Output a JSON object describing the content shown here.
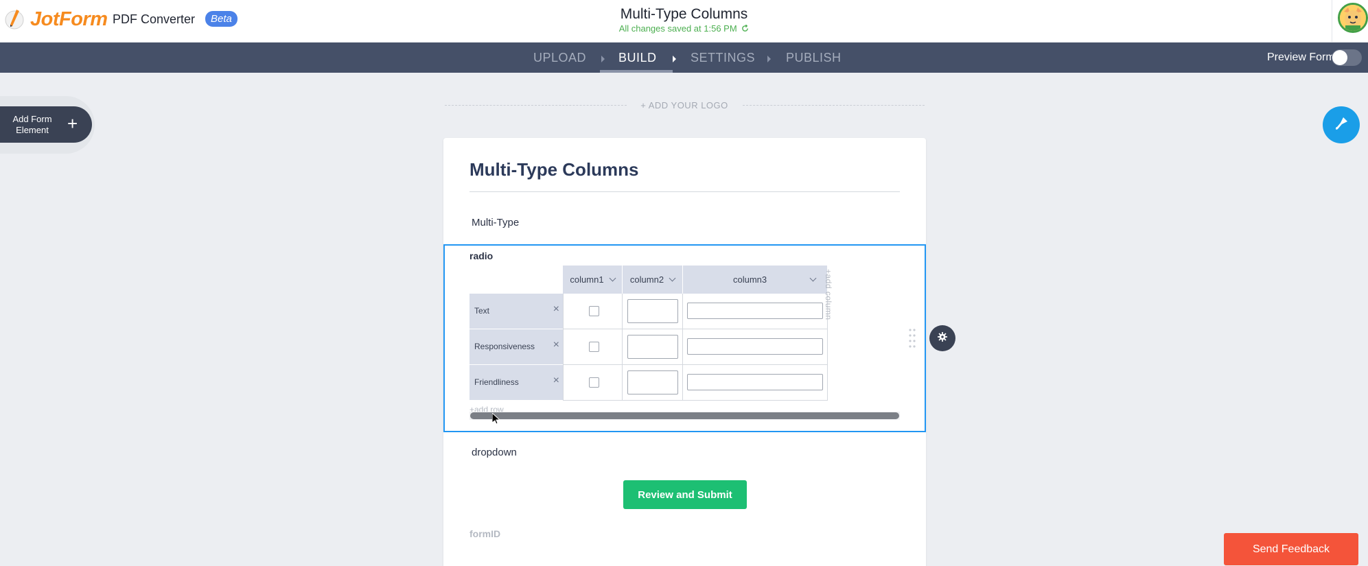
{
  "header": {
    "brand": "JotForm",
    "product": "PDF Converter",
    "badge": "Beta",
    "title": "Multi-Type Columns",
    "save_status": "All changes saved at 1:56 PM"
  },
  "nav": {
    "items": [
      {
        "label": "UPLOAD",
        "active": false
      },
      {
        "label": "BUILD",
        "active": true
      },
      {
        "label": "SETTINGS",
        "active": false
      },
      {
        "label": "PUBLISH",
        "active": false
      }
    ],
    "preview_label": "Preview Form",
    "preview_on": false
  },
  "sidebar": {
    "add_element_label": "Add Form Element"
  },
  "logo_placeholder": "+ ADD YOUR LOGO",
  "form": {
    "title": "Multi-Type Columns",
    "field1_label": "Multi-Type",
    "matrix": {
      "label": "radio",
      "columns": [
        "column1",
        "column2",
        "column3"
      ],
      "rows": [
        "Text",
        "Responsiveness",
        "Friendliness"
      ],
      "add_column": "+add column",
      "add_row": "+add row"
    },
    "field3_label": "dropdown",
    "submit_label": "Review and Submit",
    "formid_label": "formID"
  },
  "feedback_label": "Send Feedback",
  "colors": {
    "accent": "#2196f3",
    "nav_bg": "#455068",
    "submit": "#1dbf73",
    "feedback": "#f4543a",
    "brand_orange": "#f68b1f"
  }
}
